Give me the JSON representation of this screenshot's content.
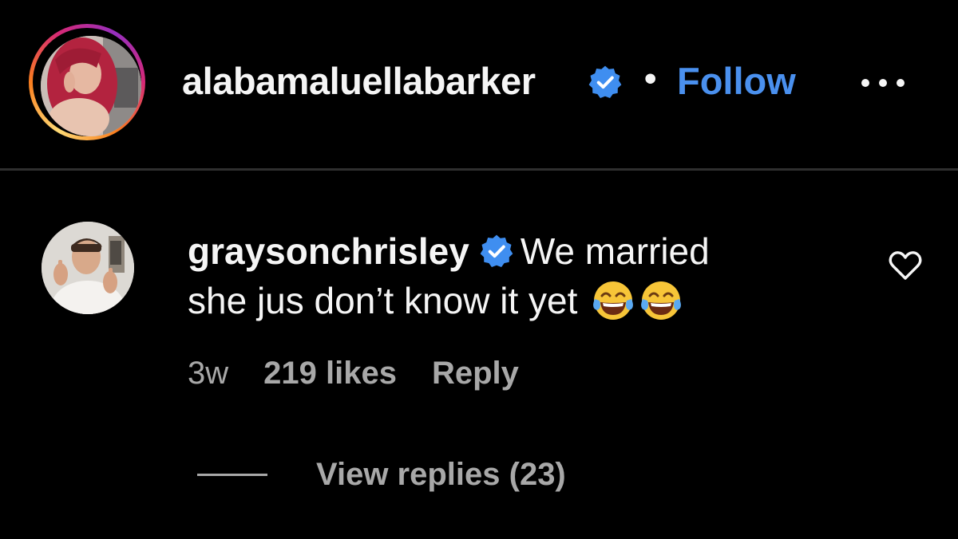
{
  "post_header": {
    "username": "alabamaluellabarker",
    "verified_icon": "verified-badge-icon",
    "separator": "•",
    "follow_label": "Follow",
    "more_icon": "more-options-icon"
  },
  "comment": {
    "username": "graysonchrisley",
    "verified_icon": "verified-badge-icon",
    "text_line1": "We married",
    "text_line2": "she jus don’t know it yet",
    "emojis": [
      "face-with-tears-of-joy-icon",
      "face-with-tears-of-joy-icon"
    ],
    "time": "3w",
    "likes": "219 likes",
    "reply_label": "Reply",
    "view_replies": "View replies (23)",
    "like_icon": "heart-outline-icon"
  },
  "colors": {
    "background": "#000000",
    "text": "#f5f5f5",
    "muted": "#a8a8a8",
    "follow_blue": "#4a90ee",
    "verified_blue": "#3f8ef0",
    "divider": "#2f2f2f"
  }
}
